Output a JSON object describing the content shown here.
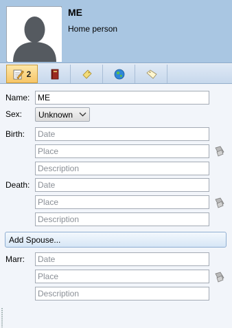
{
  "person": {
    "name": "ME",
    "subtitle": "Home person"
  },
  "tabs": [
    {
      "icon": "note-pencil-icon",
      "count": "2"
    },
    {
      "icon": "book-icon"
    },
    {
      "icon": "tag-icon"
    },
    {
      "icon": "globe-icon"
    },
    {
      "icon": "label-tag-icon"
    }
  ],
  "form": {
    "name_label": "Name:",
    "name_value": "ME",
    "sex_label": "Sex:",
    "sex_value": "Unknown",
    "birth_label": "Birth:",
    "death_label": "Death:",
    "marr_label": "Marr:",
    "date_placeholder": "Date",
    "place_placeholder": "Place",
    "description_placeholder": "Description",
    "add_spouse_label": "Add Spouse..."
  },
  "colors": {
    "header_bg": "#a9c6e2",
    "active_tab": "#f7c667",
    "panel_bg": "#f2f5fa"
  }
}
